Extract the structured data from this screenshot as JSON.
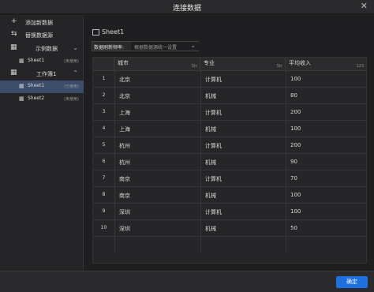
{
  "dialog": {
    "title": "连接数据",
    "close_glyph": "✕"
  },
  "sidebar": {
    "add_data": {
      "icon": "+",
      "label": "添加新数据"
    },
    "replace_source": {
      "icon": "⇆",
      "label": "替换数据源"
    },
    "sample_group": {
      "label": "示例数据",
      "chevron": "⌄"
    },
    "sample_sheet1": {
      "label": "Sheet1",
      "tag": "(未使用)"
    },
    "workbook_group": {
      "label": "工作簿1",
      "chevron": "⌃"
    },
    "workbook_sheet1": {
      "label": "Sheet1",
      "tag": "(已使用)"
    },
    "workbook_sheet2": {
      "label": "Sheet2",
      "tag": "(未使用)"
    }
  },
  "main": {
    "sheet_title": "Sheet1",
    "refresh": {
      "label": "数据刷新频率:",
      "value": "根据数据源统一设置"
    },
    "columns": [
      {
        "name": "城市",
        "type": "Str"
      },
      {
        "name": "专业",
        "type": "Str"
      },
      {
        "name": "平均收入",
        "type": "123"
      }
    ],
    "rows": [
      {
        "idx": "1",
        "city": "北京",
        "major": "计算机",
        "income": "100"
      },
      {
        "idx": "2",
        "city": "北京",
        "major": "机械",
        "income": "80"
      },
      {
        "idx": "3",
        "city": "上海",
        "major": "计算机",
        "income": "200"
      },
      {
        "idx": "4",
        "city": "上海",
        "major": "机械",
        "income": "100"
      },
      {
        "idx": "5",
        "city": "杭州",
        "major": "计算机",
        "income": "200"
      },
      {
        "idx": "6",
        "city": "杭州",
        "major": "机械",
        "income": "90"
      },
      {
        "idx": "7",
        "city": "南京",
        "major": "计算机",
        "income": "70"
      },
      {
        "idx": "8",
        "city": "南京",
        "major": "机械",
        "income": "100"
      },
      {
        "idx": "9",
        "city": "深圳",
        "major": "计算机",
        "income": "100"
      },
      {
        "idx": "10",
        "city": "深圳",
        "major": "机械",
        "income": "50"
      }
    ]
  },
  "footer": {
    "ok_label": "确定"
  },
  "colors": {
    "accent": "#1e6fe0",
    "selected": "#3b4d68"
  }
}
